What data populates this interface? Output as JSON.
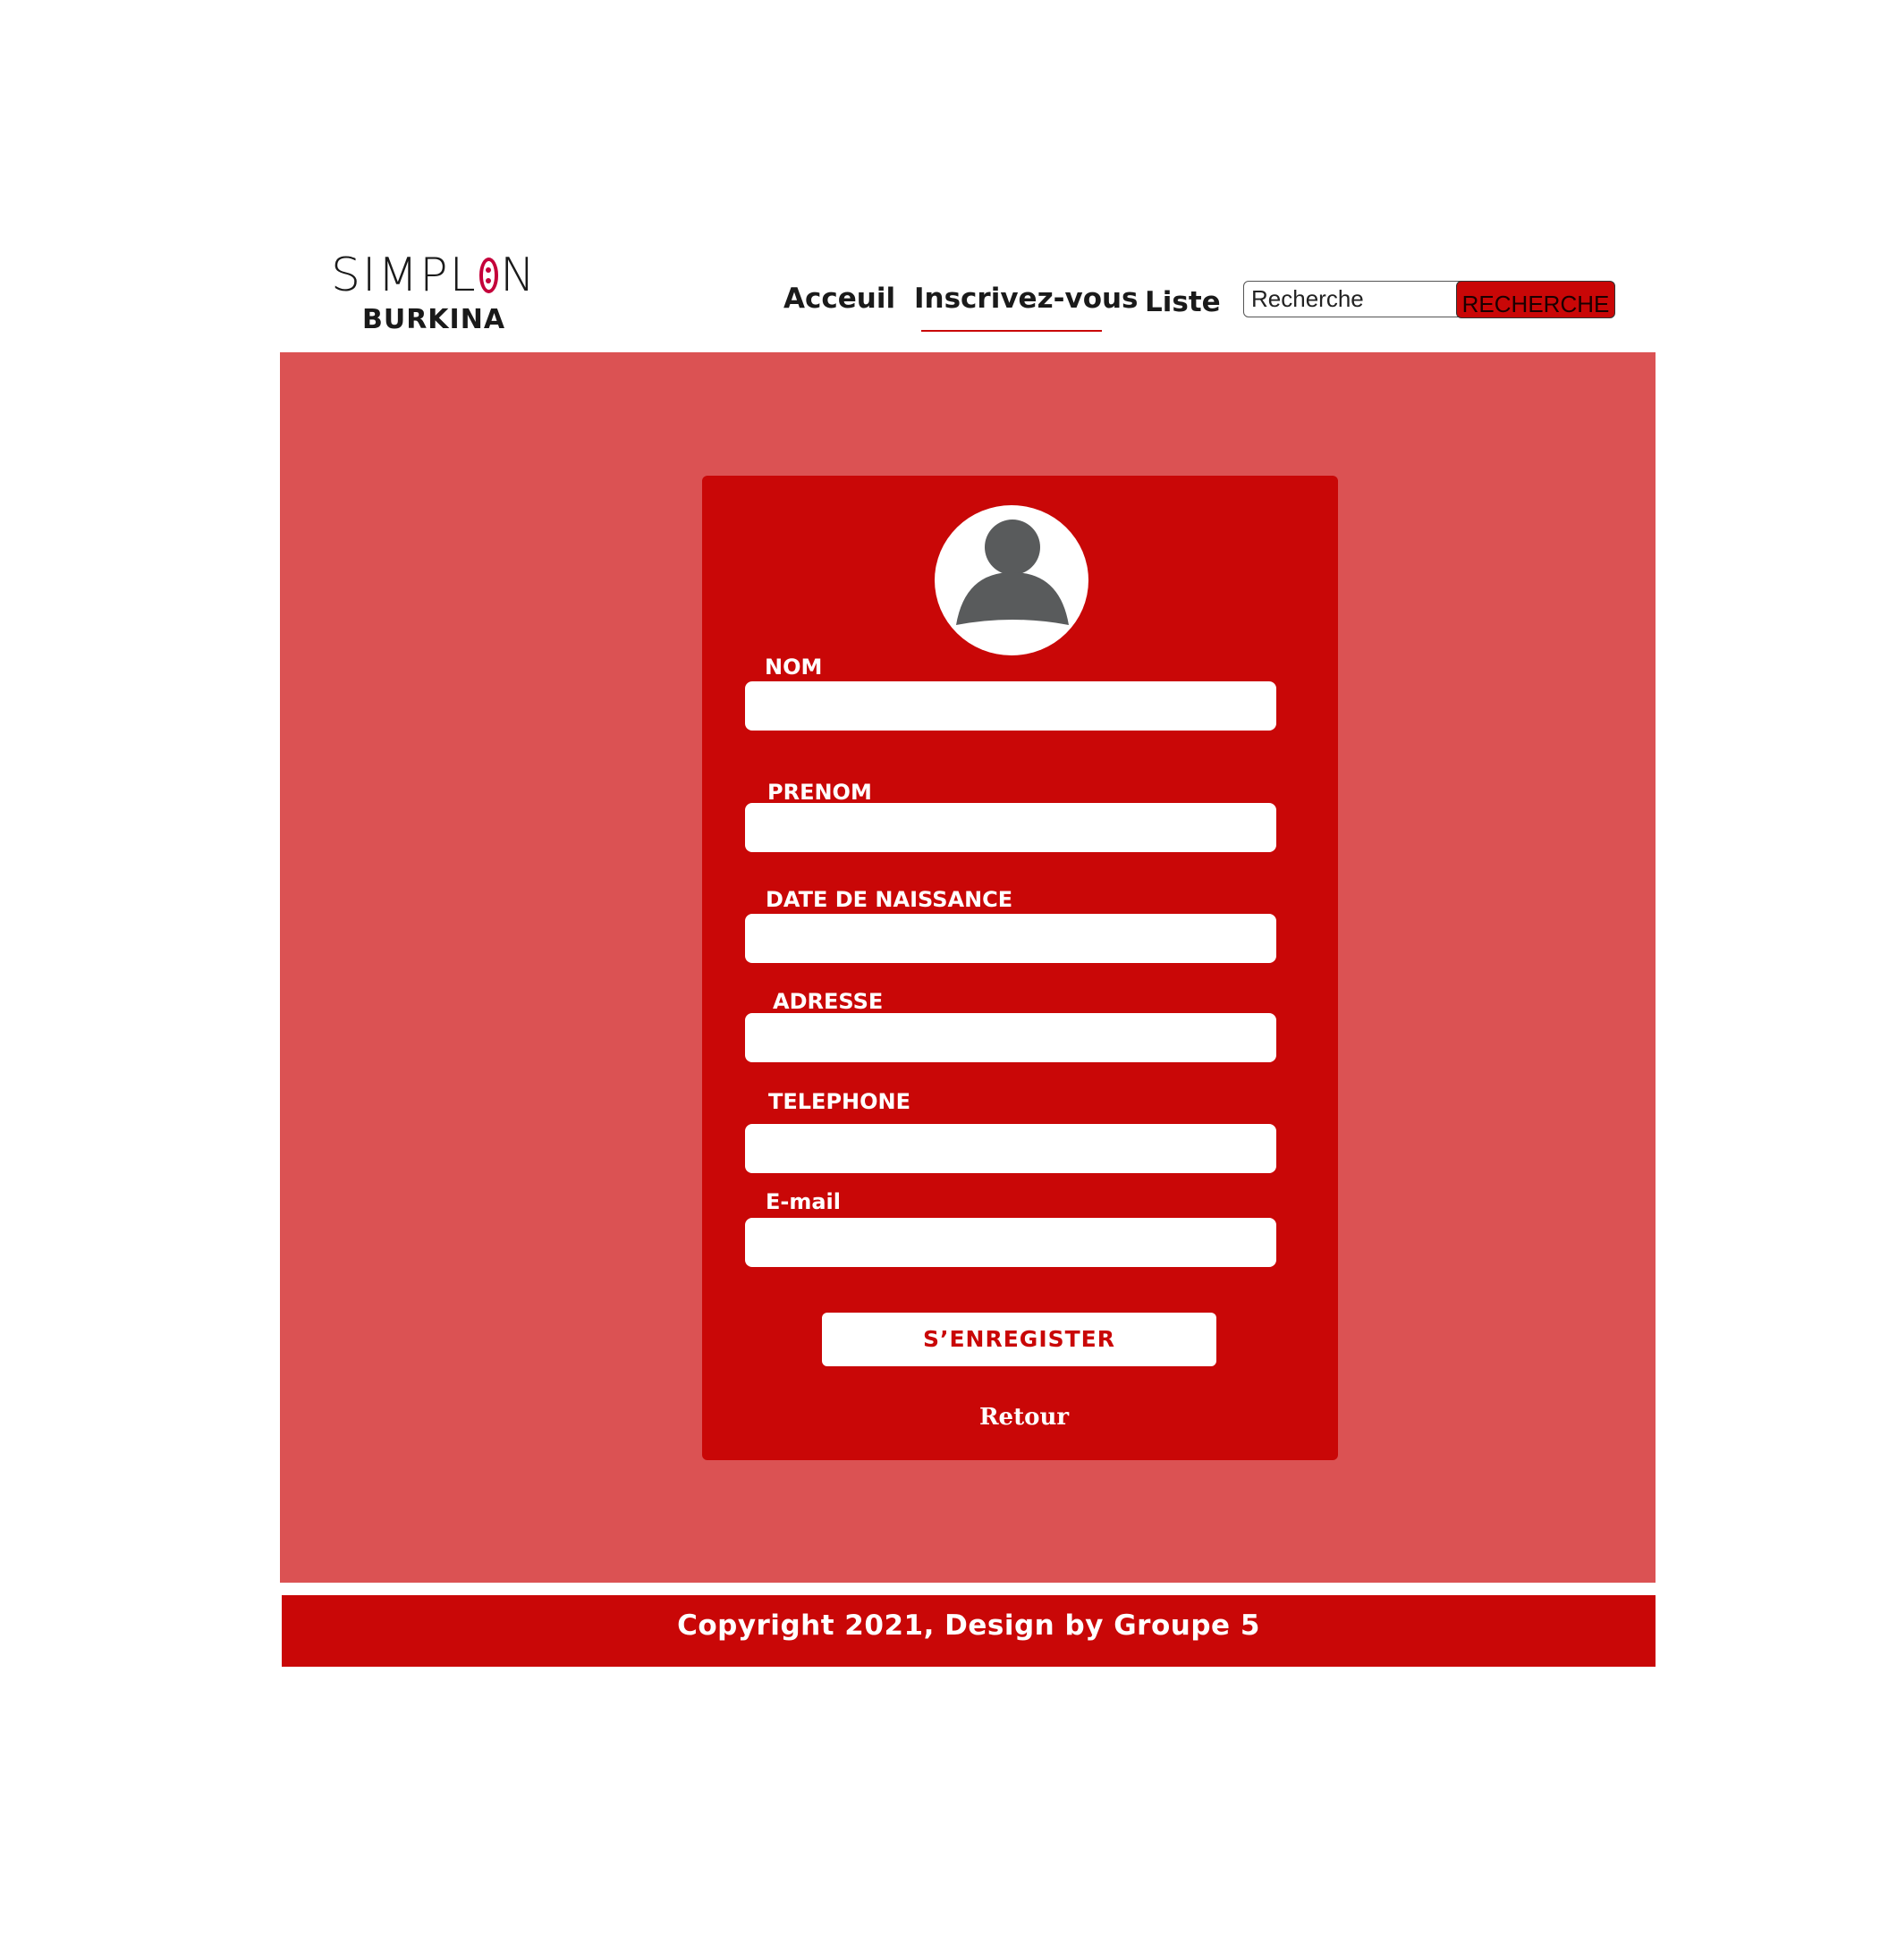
{
  "brand": {
    "logo_prefix": "SIMPL",
    "logo_suffix": "N",
    "logo_subtitle": "BURKINA",
    "accent_color": "#c4003a"
  },
  "nav": {
    "items": [
      {
        "label": "Acceuil",
        "active": false
      },
      {
        "label": "Inscrivez-vous",
        "active": true
      },
      {
        "label": "Liste",
        "active": false
      }
    ]
  },
  "search": {
    "placeholder": "Recherche",
    "value": "",
    "button_label": "RECHERCHE"
  },
  "form": {
    "avatar_icon": "user-avatar-icon",
    "fields": [
      {
        "label": "NOM",
        "value": ""
      },
      {
        "label": "PRENOM",
        "value": ""
      },
      {
        "label": "DATE DE NAISSANCE",
        "value": ""
      },
      {
        "label": "ADRESSE",
        "value": ""
      },
      {
        "label": "TELEPHONE",
        "value": ""
      },
      {
        "label": "E-mail",
        "value": ""
      }
    ],
    "submit_label": "S’ENREGISTER",
    "back_label": "Retour"
  },
  "footer": {
    "text": "Copyright 2021, Design by Groupe 5"
  },
  "colors": {
    "primary_red": "#c90707",
    "background_red": "#db5253",
    "avatar_gray": "#595b5c",
    "white": "#ffffff"
  }
}
